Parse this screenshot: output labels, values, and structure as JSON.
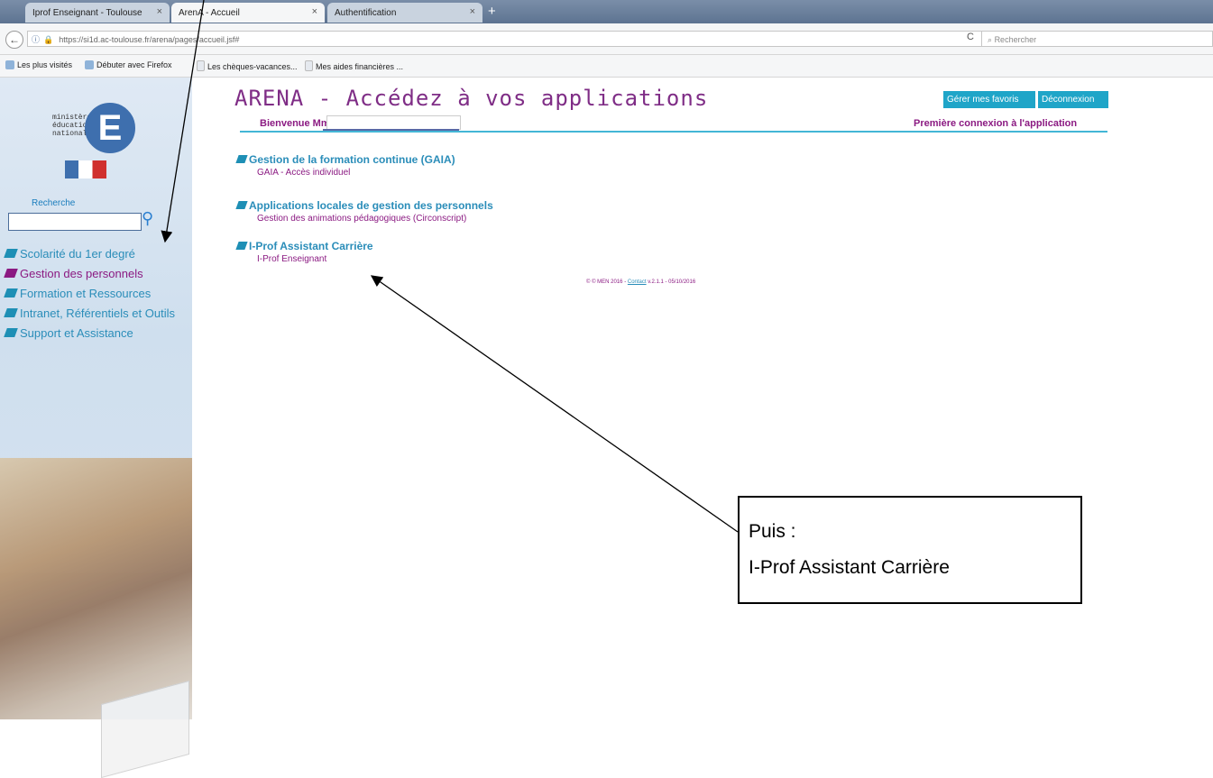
{
  "browser": {
    "tabs": [
      {
        "label": "Iprof Enseignant - Toulouse",
        "active": false
      },
      {
        "label": "ArenA - Accueil",
        "active": true
      },
      {
        "label": "Authentification",
        "active": false
      }
    ],
    "url": "https://si1d.ac-toulouse.fr/arena/pages/accueil.jsf#",
    "search_placeholder": "Rechercher",
    "bookmarks": [
      "Les plus visités",
      "Débuter avec Firefox",
      "Les chèques-vacances...",
      "Mes aides financières ..."
    ]
  },
  "sidebar": {
    "logo_text": [
      "ministère",
      "éducation",
      "nationale"
    ],
    "search_label": "Recherche",
    "menu": [
      {
        "label": "Scolarité du 1er degré",
        "active": false
      },
      {
        "label": "Gestion des personnels",
        "active": true
      },
      {
        "label": "Formation et Ressources",
        "active": false
      },
      {
        "label": "Intranet, Référentiels et Outils",
        "active": false
      },
      {
        "label": "Support et Assistance",
        "active": false
      }
    ]
  },
  "header": {
    "title": "ARENA - Accédez à vos applications",
    "btn_favoris": "Gérer mes favoris",
    "btn_logout": "Déconnexion",
    "welcome": "Bienvenue Mme",
    "first_connection": "Première connexion à l'application"
  },
  "sections": [
    {
      "title": "Gestion de la formation continue (GAIA)",
      "link": "GAIA - Accès individuel"
    },
    {
      "title": "Applications locales de gestion des personnels",
      "link": "Gestion des animations pédagogiques (Circonscript)"
    },
    {
      "title": "I-Prof Assistant Carrière",
      "link": "I-Prof Enseignant"
    }
  ],
  "footer": {
    "prefix": "© © MEN 2016 -",
    "link": "Contact",
    "suffix": "v.2.1.1 - 05/10/2016"
  },
  "callout": {
    "line1": "Puis :",
    "line2": "I-Prof Assistant Carrière"
  },
  "colors": {
    "accent": "#8b1a82",
    "link": "#2a8db9",
    "button": "#1fa5c8"
  }
}
